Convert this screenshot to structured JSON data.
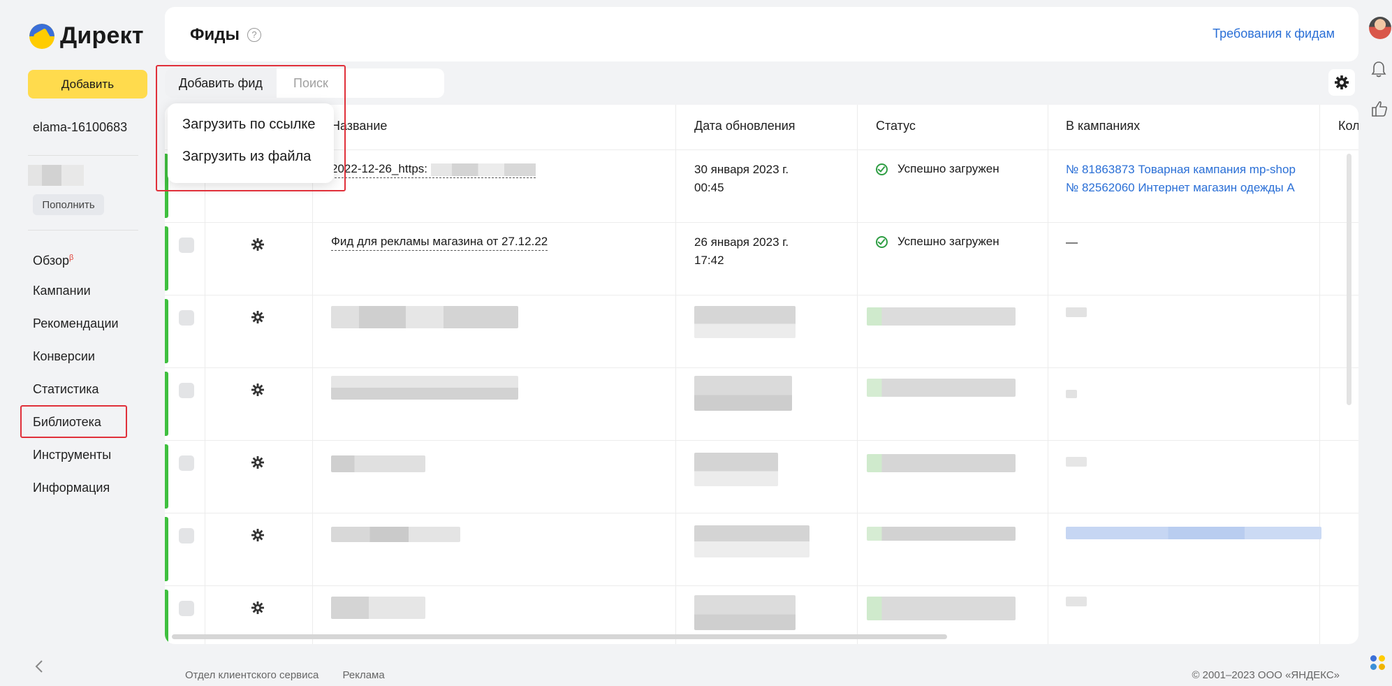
{
  "brand": {
    "logo_text": "Директ",
    "logo_icon": "direct-logo-icon"
  },
  "sidebar": {
    "add_label": "Добавить",
    "account": "elama-16100683",
    "topup_label": "Пополнить",
    "items": [
      {
        "label": "Обзор",
        "badge": "β"
      },
      {
        "label": "Кампании"
      },
      {
        "label": "Рекомендации"
      },
      {
        "label": "Конверсии"
      },
      {
        "label": "Статистика"
      },
      {
        "label": "Библиотека",
        "highlighted": true
      },
      {
        "label": "Инструменты"
      },
      {
        "label": "Информация"
      }
    ],
    "collapse_icon": "chevron-left-icon"
  },
  "header": {
    "title": "Фиды",
    "help_icon": "?",
    "requirements_link": "Требования к фидам"
  },
  "toolbar": {
    "add_feed_label": "Добавить фид",
    "search_placeholder": "Поиск"
  },
  "dropdown": {
    "items": [
      "Загрузить по ссылке",
      "Загрузить из файла"
    ]
  },
  "table": {
    "columns": [
      "Название",
      "Дата обновления",
      "Статус",
      "В кампаниях",
      "Кол"
    ],
    "rows": [
      {
        "name": "2022-12-26_https:",
        "date_line1": "30 января 2023 г.",
        "date_line2": "00:45",
        "status": "Успешно загружен",
        "campaigns": [
          "№ 81863873 Товарная кампания mp-shop",
          "№ 82562060 Интернет магазин одежды А"
        ]
      },
      {
        "name": "Фид для рекламы магазина от 27.12.22",
        "date_line1": "26 января 2023 г.",
        "date_line2": "17:42",
        "status": "Успешно загружен",
        "campaigns_empty": "—"
      }
    ]
  },
  "footer": {
    "links": [
      "Отдел клиентского сервиса",
      "Реклама"
    ],
    "copyright": "© 2001–2023 ООО «ЯНДЕКС»"
  },
  "colors": {
    "accent_yellow": "#ffdb4d",
    "link_blue": "#2a6fd6",
    "status_green": "#2f9e44",
    "highlight_red": "#e0303a"
  }
}
